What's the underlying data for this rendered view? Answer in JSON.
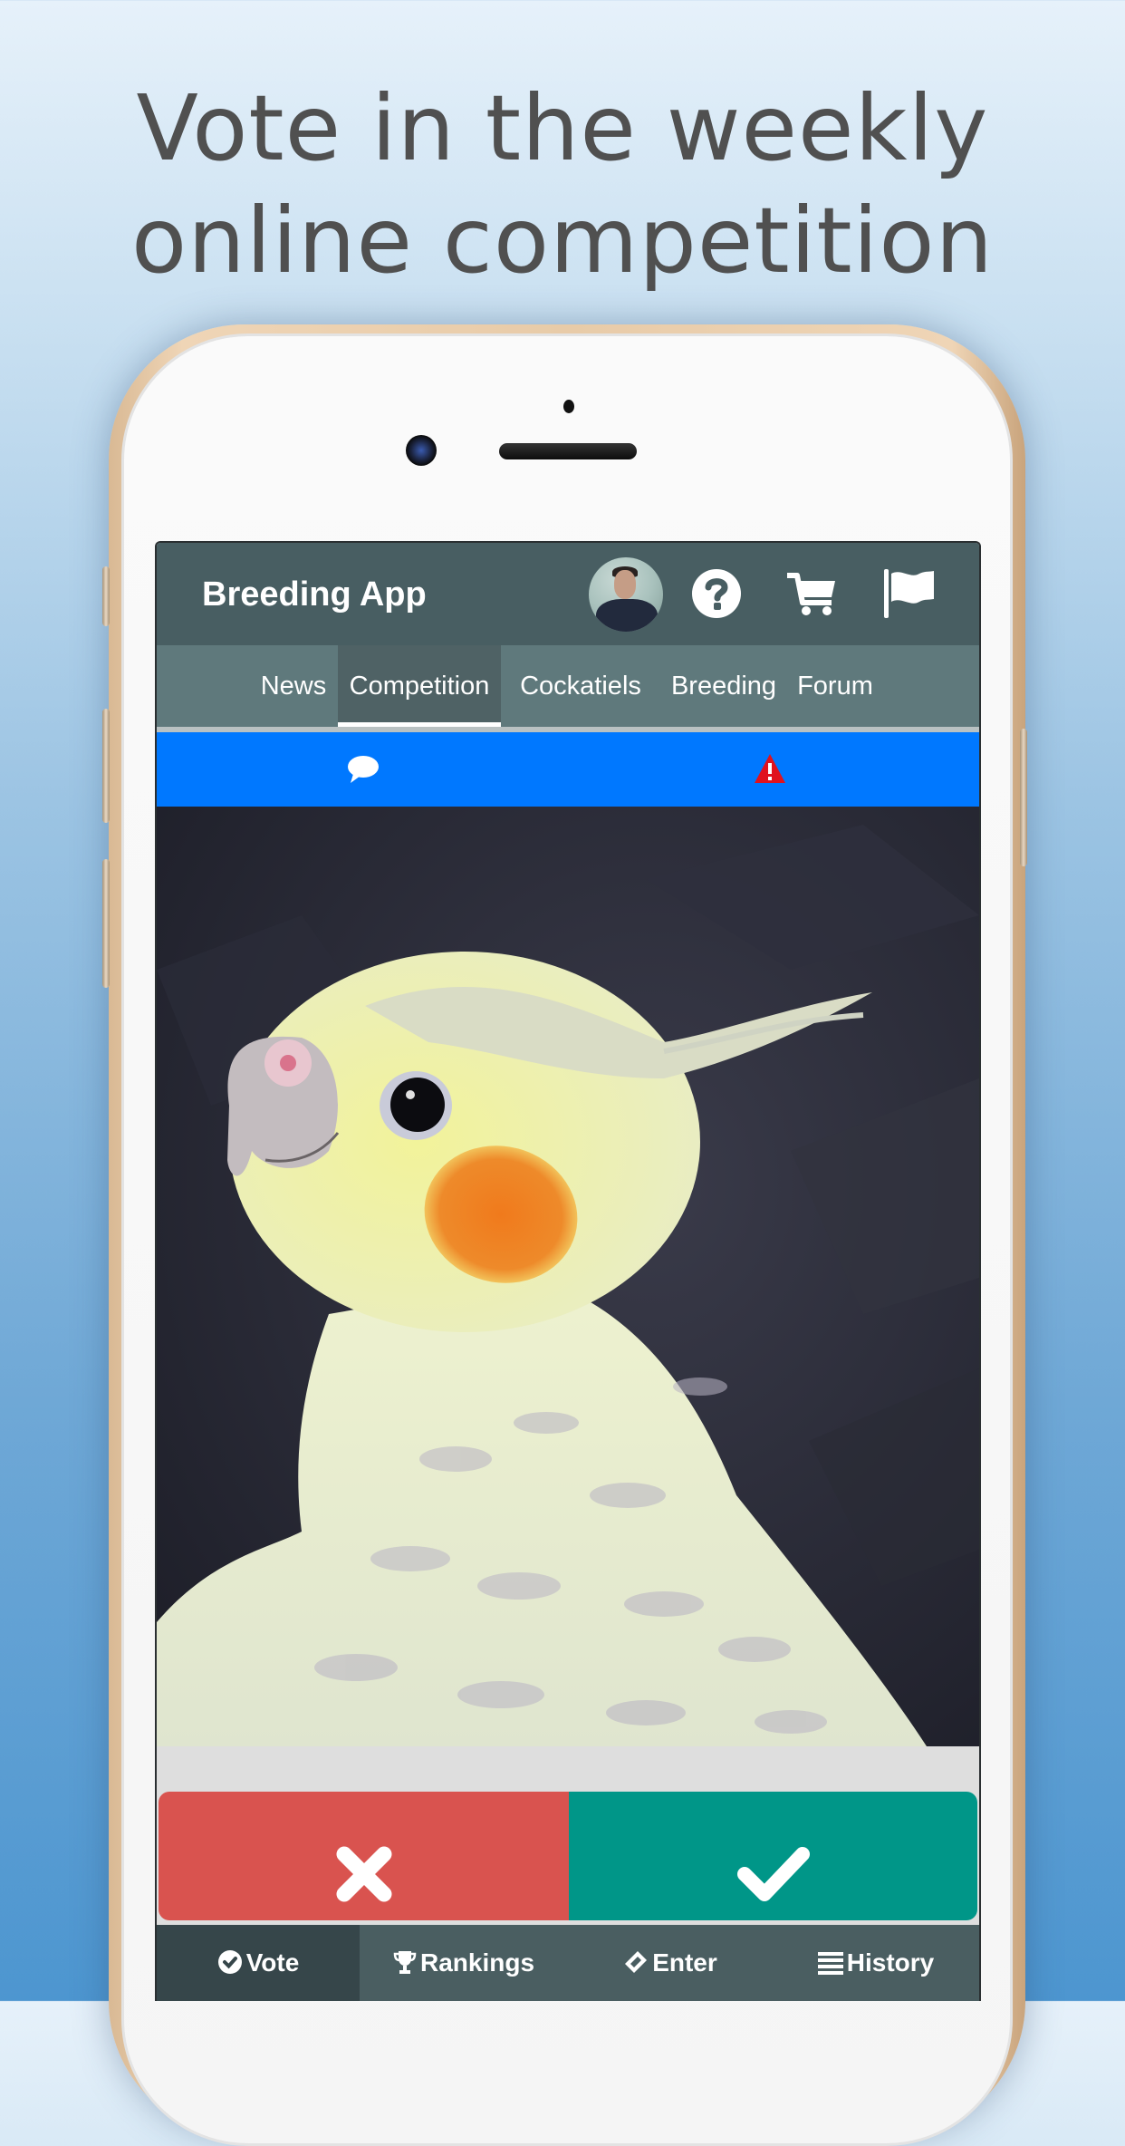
{
  "promo": {
    "headline_lines": [
      "Vote in the weekly",
      "online competition"
    ]
  },
  "app": {
    "title": "Breeding App",
    "header_icons": [
      "avatar",
      "question-circle-icon",
      "shopping-cart-icon",
      "flag-icon"
    ]
  },
  "tabs": [
    {
      "label": "News",
      "active": false
    },
    {
      "label": "Competition",
      "active": true
    },
    {
      "label": "Cockatiels",
      "active": false
    },
    {
      "label": "Breeding",
      "active": false
    },
    {
      "label": "Forum",
      "active": false
    }
  ],
  "action_bar": {
    "icons": [
      "comment-icon",
      "warning-icon"
    ]
  },
  "entry_photo": {
    "subject": "pied cockatiel with orange cheek patch on dark background"
  },
  "vote_buttons": {
    "reject_icon": "times-icon",
    "approve_icon": "check-icon"
  },
  "bottom_nav": [
    {
      "label": "Vote",
      "icon": "check-circle-icon",
      "active": true
    },
    {
      "label": "Rankings",
      "icon": "trophy-icon",
      "active": false
    },
    {
      "label": "Enter",
      "icon": "ticket-icon",
      "active": false
    },
    {
      "label": "History",
      "icon": "list-icon",
      "active": false
    }
  ],
  "colors": {
    "header": "#485e62",
    "tabbar": "#5f797c",
    "tab_active": "#4f6265",
    "action_bar": "#0078ff",
    "warning": "#e0121e",
    "reject": "#d9534f",
    "approve": "#009688",
    "bottom_nav": "#4a5e61",
    "bottom_nav_active": "#36464a"
  }
}
